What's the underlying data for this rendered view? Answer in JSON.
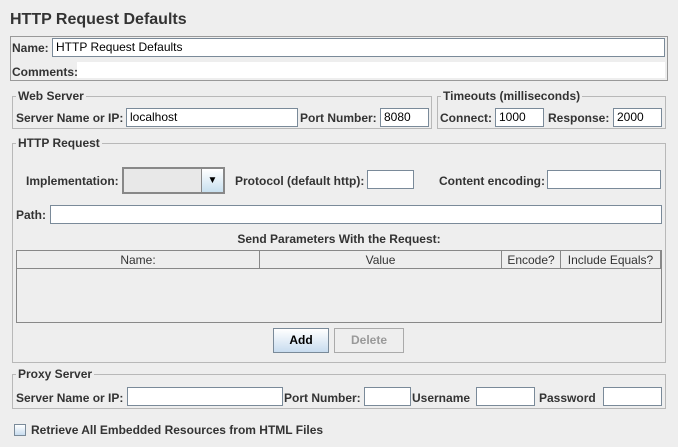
{
  "title": "HTTP Request Defaults",
  "name_label": "Name:",
  "name_value": "HTTP Request Defaults",
  "comments_label": "Comments:",
  "web_server": {
    "legend": "Web Server",
    "server_label": "Server Name or IP:",
    "server_value": "localhost",
    "port_label": "Port Number:",
    "port_value": "8080"
  },
  "timeouts": {
    "legend": "Timeouts (milliseconds)",
    "connect_label": "Connect:",
    "connect_value": "1000",
    "response_label": "Response:",
    "response_value": "2000"
  },
  "http_request": {
    "legend": "HTTP Request",
    "implementation_label": "Implementation:",
    "implementation_value": "",
    "protocol_label": "Protocol (default http):",
    "protocol_value": "",
    "encoding_label": "Content encoding:",
    "encoding_value": "",
    "path_label": "Path:",
    "path_value": "",
    "params_title": "Send Parameters With the Request:",
    "columns": [
      "Name:",
      "Value",
      "Encode?",
      "Include Equals?"
    ],
    "add_label": "Add",
    "delete_label": "Delete"
  },
  "proxy": {
    "legend": "Proxy Server",
    "server_label": "Server Name or IP:",
    "port_label": "Port Number:",
    "username_label": "Username",
    "password_label": "Password"
  },
  "retrieve_label": "Retrieve All Embedded Resources from HTML Files",
  "retrieve_checked": false
}
